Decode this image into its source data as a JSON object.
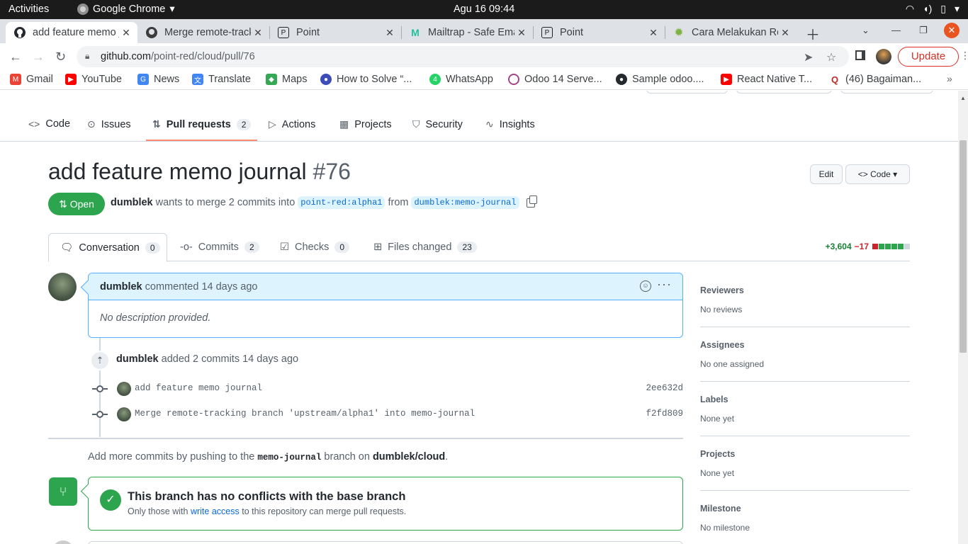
{
  "os": {
    "activities": "Activities",
    "app_name": "Google Chrome",
    "clock": "Agu 16  09:44"
  },
  "tabs": [
    {
      "title": "add feature memo journal",
      "icon": "github-icon",
      "active": true
    },
    {
      "title": "Merge remote-tracking",
      "icon": "github-icon",
      "active": false
    },
    {
      "title": "Point",
      "icon": "point-icon",
      "active": false
    },
    {
      "title": "Mailtrap - Safe Email",
      "icon": "mailtrap-icon",
      "active": false
    },
    {
      "title": "Point",
      "icon": "point-icon",
      "active": false
    },
    {
      "title": "Cara Melakukan Rebase",
      "icon": "gear-favicon-icon",
      "active": false
    }
  ],
  "address": {
    "domain": "github.com",
    "path": "/point-red/cloud/pull/76",
    "update_label": "Update"
  },
  "bookmarks": [
    {
      "label": "Gmail",
      "icon": "gmail-icon",
      "color": "#ea4335"
    },
    {
      "label": "YouTube",
      "icon": "youtube-icon",
      "color": "#ff0000"
    },
    {
      "label": "News",
      "icon": "news-icon",
      "color": "#4285f4"
    },
    {
      "label": "Translate",
      "icon": "translate-icon",
      "color": "#4285f4"
    },
    {
      "label": "Maps",
      "icon": "maps-icon",
      "color": "#34a853"
    },
    {
      "label": "How to Solve “...",
      "icon": "shield-icon",
      "color": "#3c4cb8"
    },
    {
      "label": "WhatsApp",
      "icon": "whatsapp-icon",
      "color": "#25d366"
    },
    {
      "label": "Odoo 14 Serve...",
      "icon": "odoo-icon",
      "color": "#a24689"
    },
    {
      "label": "Sample odoo....",
      "icon": "github-icon",
      "color": "#24292f"
    },
    {
      "label": "React Native T...",
      "icon": "youtube-icon",
      "color": "#ff0000"
    },
    {
      "label": "(46) Bagaiman...",
      "icon": "quora-icon",
      "color": "#b92b27"
    }
  ],
  "repo_nav": {
    "code": "Code",
    "issues": "Issues",
    "pull_requests": "Pull requests",
    "pull_requests_count": "2",
    "actions": "Actions",
    "projects": "Projects",
    "security": "Security",
    "insights": "Insights"
  },
  "pr": {
    "title": "add feature memo journal",
    "number": "#76",
    "edit_label": "Edit",
    "code_label": "Code",
    "state": "Open",
    "author": "dumblek",
    "merge_text": "wants to merge 2 commits into",
    "base_branch": "point-red:alpha1",
    "from_text": "from",
    "head_branch": "dumblek:memo-journal"
  },
  "pr_tabs": {
    "conversation": "Conversation",
    "conversation_count": "0",
    "commits": "Commits",
    "commits_count": "2",
    "checks": "Checks",
    "checks_count": "0",
    "files": "Files changed",
    "files_count": "23",
    "additions": "+3,604",
    "deletions": "−17"
  },
  "comment": {
    "author": "dumblek",
    "action": "commented 14 days ago",
    "body": "No description provided."
  },
  "event": {
    "author": "dumblek",
    "action": "added 2 commits 14 days ago"
  },
  "commits": [
    {
      "message": "add feature memo journal",
      "sha": "2ee632d"
    },
    {
      "message": "Merge remote-tracking branch 'upstream/alpha1' into memo-journal",
      "sha": "f2fd809"
    }
  ],
  "push_hint": {
    "before": "Add more commits by pushing to the",
    "branch": "memo-journal",
    "middle": "branch on",
    "repo": "dumblek/cloud",
    "end": "."
  },
  "merge": {
    "title": "This branch has no conflicts with the base branch",
    "sub_before": "Only those with",
    "sub_link": "write access",
    "sub_after": "to this repository can merge pull requests."
  },
  "sidebar": [
    {
      "heading": "Reviewers",
      "value": "No reviews"
    },
    {
      "heading": "Assignees",
      "value": "No one assigned"
    },
    {
      "heading": "Labels",
      "value": "None yet"
    },
    {
      "heading": "Projects",
      "value": "None yet"
    },
    {
      "heading": "Milestone",
      "value": "No milestone"
    }
  ],
  "colors": {
    "accent_green": "#2da44e",
    "link_blue": "#0969da",
    "tab_underline": "#fd8c73"
  }
}
